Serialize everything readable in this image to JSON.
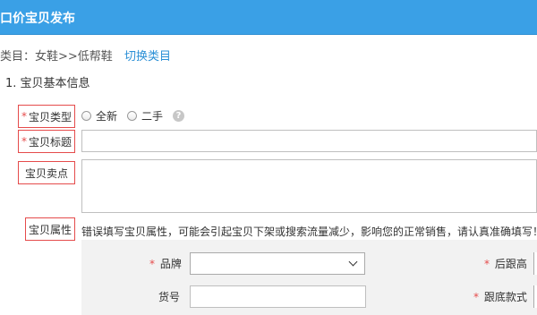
{
  "header": {
    "title": "口价宝贝发布"
  },
  "category": {
    "label": "类目：女鞋>>低帮鞋",
    "switch_link": "切换类目"
  },
  "section": {
    "title": "1. 宝贝基本信息"
  },
  "required_mark": "*",
  "fields": {
    "type": {
      "label": "宝贝类型",
      "options": [
        "全新",
        "二手"
      ],
      "help_icon": "?"
    },
    "title": {
      "label": "宝贝标题",
      "value": ""
    },
    "selling_point": {
      "label": "宝贝卖点",
      "value": ""
    },
    "attributes": {
      "label": "宝贝属性",
      "warning": "错误填写宝贝属性，可能会引起宝贝下架或搜索流量减少，影响您的正常销售，请认真准确填写！",
      "brand_label": "品牌",
      "brand_value": "",
      "item_no_label": "货号",
      "item_no_value": "",
      "heel_height_label": "后跟高",
      "heel_style_label": "跟底款式"
    }
  },
  "colors": {
    "header_bg": "#3aa0e6",
    "link": "#2a8fd6",
    "required": "#e54b4b",
    "label_border": "#e54b4b"
  }
}
